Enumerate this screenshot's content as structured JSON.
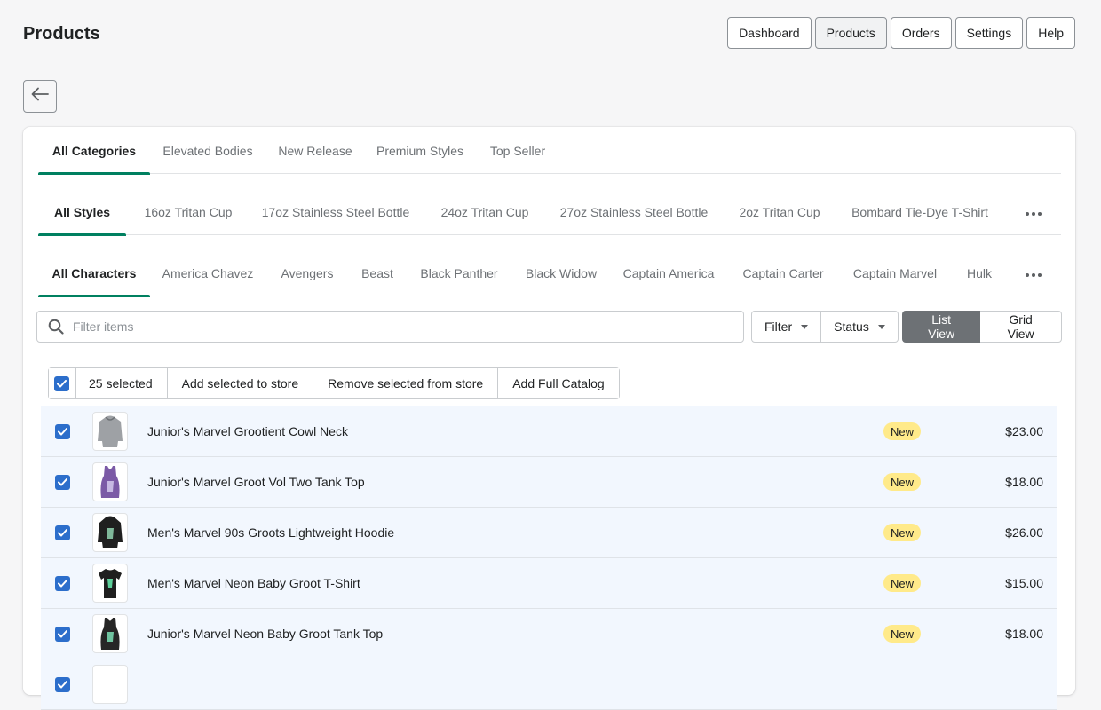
{
  "page": {
    "title": "Products"
  },
  "topnav": [
    "Dashboard",
    "Products",
    "Orders",
    "Settings",
    "Help"
  ],
  "topnav_active": "Products",
  "categories": [
    "All Categories",
    "Elevated Bodies",
    "New Release",
    "Premium Styles",
    "Top Seller"
  ],
  "styles": [
    "All Styles",
    "16oz Tritan Cup",
    "17oz Stainless Steel Bottle",
    "24oz Tritan Cup",
    "27oz Stainless Steel Bottle",
    "2oz Tritan Cup",
    "Bombard Tie-Dye T-Shirt"
  ],
  "characters": [
    "All Characters",
    "America Chavez",
    "Avengers",
    "Beast",
    "Black Panther",
    "Black Widow",
    "Captain America",
    "Captain Carter",
    "Captain Marvel",
    "Hulk"
  ],
  "search": {
    "placeholder": "Filter items"
  },
  "filters": {
    "filter_label": "Filter",
    "status_label": "Status"
  },
  "views": {
    "list_label": "List View",
    "grid_label": "Grid View",
    "active": "List View"
  },
  "bulk": {
    "selected_label": "25 selected",
    "add_label": "Add selected to store",
    "remove_label": "Remove selected from store",
    "catalog_label": "Add Full Catalog"
  },
  "products": [
    {
      "name": "Junior's Marvel Grootient Cowl Neck",
      "badge": "New",
      "price": "$23.00",
      "thumb": "gray-hoodie"
    },
    {
      "name": "Junior's Marvel Groot Vol Two Tank Top",
      "badge": "New",
      "price": "$18.00",
      "thumb": "purple-tank"
    },
    {
      "name": "Men's Marvel 90s Groots Lightweight Hoodie",
      "badge": "New",
      "price": "$26.00",
      "thumb": "black-hoodie"
    },
    {
      "name": "Men's Marvel Neon Baby Groot T-Shirt",
      "badge": "New",
      "price": "$15.00",
      "thumb": "black-tshirt"
    },
    {
      "name": "Junior's Marvel Neon Baby Groot Tank Top",
      "badge": "New",
      "price": "$18.00",
      "thumb": "black-tank"
    }
  ],
  "colors": {
    "accent": "#008060",
    "checkbox": "#2c6ecb",
    "badge": "#ffea8a",
    "row_selected": "#f2f7fe"
  }
}
